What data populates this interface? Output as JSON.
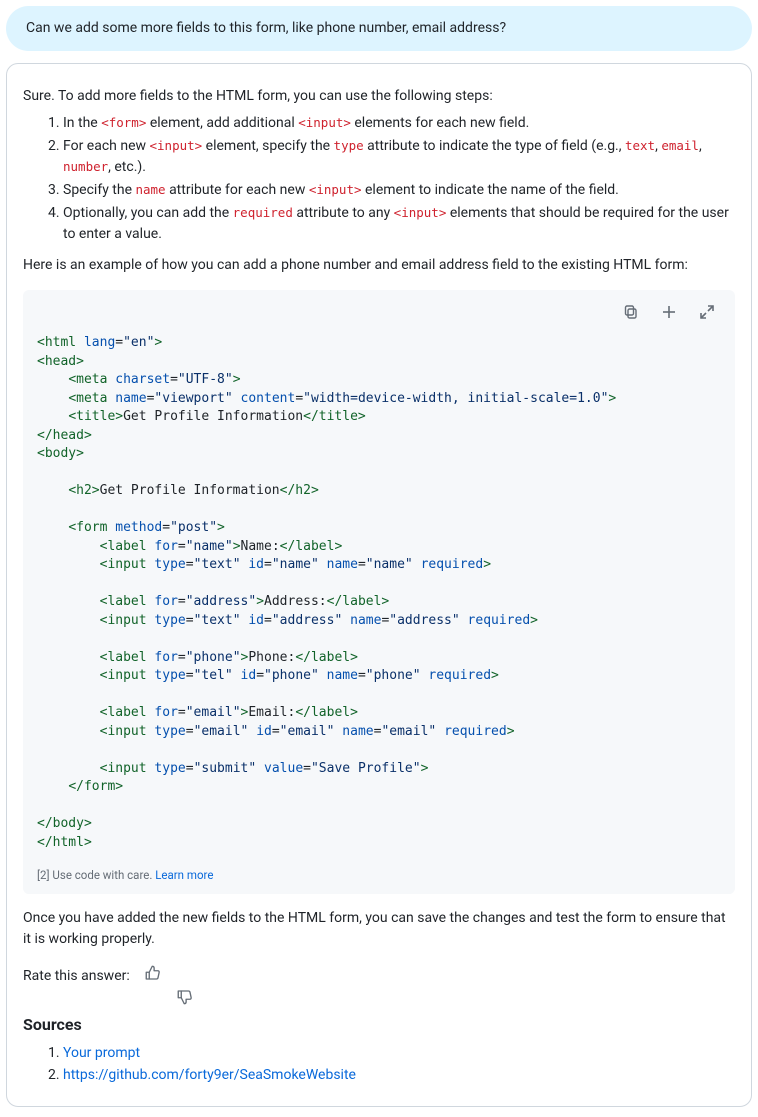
{
  "user_message": "Can we add some more fields to this form, like phone number, email address?",
  "answer": {
    "intro": "Sure. To add more fields to the HTML form, you can use the following steps:",
    "steps": [
      [
        {
          "t": "In the "
        },
        {
          "c": "<form>"
        },
        {
          "t": " element, add additional "
        },
        {
          "c": "<input>"
        },
        {
          "t": " elements for each new field."
        }
      ],
      [
        {
          "t": "For each new "
        },
        {
          "c": "<input>"
        },
        {
          "t": " element, specify the "
        },
        {
          "c": "type"
        },
        {
          "t": " attribute to indicate the type of field (e.g., "
        },
        {
          "c": "text"
        },
        {
          "t": ", "
        },
        {
          "c": "email"
        },
        {
          "t": ", "
        },
        {
          "c": "number"
        },
        {
          "t": ", etc.)."
        }
      ],
      [
        {
          "t": "Specify the "
        },
        {
          "c": "name"
        },
        {
          "t": " attribute for each new "
        },
        {
          "c": "<input>"
        },
        {
          "t": " element to indicate the name of the field."
        }
      ],
      [
        {
          "t": "Optionally, you can add the "
        },
        {
          "c": "required"
        },
        {
          "t": " attribute to any "
        },
        {
          "c": "<input>"
        },
        {
          "t": " elements that should be required for the user to enter a value."
        }
      ]
    ],
    "example_lead": "Here is an example of how you can add a phone number and email address field to the existing HTML form:",
    "code_lines": [
      [
        [
          "tag",
          "<html"
        ],
        [
          "punc",
          " "
        ],
        [
          "attr",
          "lang"
        ],
        [
          "punc",
          "="
        ],
        [
          "str",
          "\"en\""
        ],
        [
          "tag",
          ">"
        ]
      ],
      [
        [
          "tag",
          "<head>"
        ]
      ],
      [
        [
          "punc",
          "    "
        ],
        [
          "tag",
          "<meta"
        ],
        [
          "punc",
          " "
        ],
        [
          "attr",
          "charset"
        ],
        [
          "punc",
          "="
        ],
        [
          "str",
          "\"UTF-8\""
        ],
        [
          "tag",
          ">"
        ]
      ],
      [
        [
          "punc",
          "    "
        ],
        [
          "tag",
          "<meta"
        ],
        [
          "punc",
          " "
        ],
        [
          "attr",
          "name"
        ],
        [
          "punc",
          "="
        ],
        [
          "str",
          "\"viewport\""
        ],
        [
          "punc",
          " "
        ],
        [
          "attr",
          "content"
        ],
        [
          "punc",
          "="
        ],
        [
          "str",
          "\"width=device-width, initial-scale=1.0\""
        ],
        [
          "tag",
          ">"
        ]
      ],
      [
        [
          "punc",
          "    "
        ],
        [
          "tag",
          "<title>"
        ],
        [
          "text",
          "Get Profile Information"
        ],
        [
          "tag",
          "</title>"
        ]
      ],
      [
        [
          "tag",
          "</head>"
        ]
      ],
      [
        [
          "tag",
          "<body>"
        ]
      ],
      [],
      [
        [
          "punc",
          "    "
        ],
        [
          "tag",
          "<h2>"
        ],
        [
          "text",
          "Get Profile Information"
        ],
        [
          "tag",
          "</h2>"
        ]
      ],
      [],
      [
        [
          "punc",
          "    "
        ],
        [
          "tag",
          "<form"
        ],
        [
          "punc",
          " "
        ],
        [
          "attr",
          "method"
        ],
        [
          "punc",
          "="
        ],
        [
          "str",
          "\"post\""
        ],
        [
          "tag",
          ">"
        ]
      ],
      [
        [
          "punc",
          "        "
        ],
        [
          "tag",
          "<label"
        ],
        [
          "punc",
          " "
        ],
        [
          "attr",
          "for"
        ],
        [
          "punc",
          "="
        ],
        [
          "str",
          "\"name\""
        ],
        [
          "tag",
          ">"
        ],
        [
          "text",
          "Name:"
        ],
        [
          "tag",
          "</label>"
        ]
      ],
      [
        [
          "punc",
          "        "
        ],
        [
          "tag",
          "<input"
        ],
        [
          "punc",
          " "
        ],
        [
          "attr",
          "type"
        ],
        [
          "punc",
          "="
        ],
        [
          "str",
          "\"text\""
        ],
        [
          "punc",
          " "
        ],
        [
          "attr",
          "id"
        ],
        [
          "punc",
          "="
        ],
        [
          "str",
          "\"name\""
        ],
        [
          "punc",
          " "
        ],
        [
          "attr",
          "name"
        ],
        [
          "punc",
          "="
        ],
        [
          "str",
          "\"name\""
        ],
        [
          "punc",
          " "
        ],
        [
          "attr",
          "required"
        ],
        [
          "tag",
          ">"
        ]
      ],
      [],
      [
        [
          "punc",
          "        "
        ],
        [
          "tag",
          "<label"
        ],
        [
          "punc",
          " "
        ],
        [
          "attr",
          "for"
        ],
        [
          "punc",
          "="
        ],
        [
          "str",
          "\"address\""
        ],
        [
          "tag",
          ">"
        ],
        [
          "text",
          "Address:"
        ],
        [
          "tag",
          "</label>"
        ]
      ],
      [
        [
          "punc",
          "        "
        ],
        [
          "tag",
          "<input"
        ],
        [
          "punc",
          " "
        ],
        [
          "attr",
          "type"
        ],
        [
          "punc",
          "="
        ],
        [
          "str",
          "\"text\""
        ],
        [
          "punc",
          " "
        ],
        [
          "attr",
          "id"
        ],
        [
          "punc",
          "="
        ],
        [
          "str",
          "\"address\""
        ],
        [
          "punc",
          " "
        ],
        [
          "attr",
          "name"
        ],
        [
          "punc",
          "="
        ],
        [
          "str",
          "\"address\""
        ],
        [
          "punc",
          " "
        ],
        [
          "attr",
          "required"
        ],
        [
          "tag",
          ">"
        ]
      ],
      [],
      [
        [
          "punc",
          "        "
        ],
        [
          "tag",
          "<label"
        ],
        [
          "punc",
          " "
        ],
        [
          "attr",
          "for"
        ],
        [
          "punc",
          "="
        ],
        [
          "str",
          "\"phone\""
        ],
        [
          "tag",
          ">"
        ],
        [
          "text",
          "Phone:"
        ],
        [
          "tag",
          "</label>"
        ]
      ],
      [
        [
          "punc",
          "        "
        ],
        [
          "tag",
          "<input"
        ],
        [
          "punc",
          " "
        ],
        [
          "attr",
          "type"
        ],
        [
          "punc",
          "="
        ],
        [
          "str",
          "\"tel\""
        ],
        [
          "punc",
          " "
        ],
        [
          "attr",
          "id"
        ],
        [
          "punc",
          "="
        ],
        [
          "str",
          "\"phone\""
        ],
        [
          "punc",
          " "
        ],
        [
          "attr",
          "name"
        ],
        [
          "punc",
          "="
        ],
        [
          "str",
          "\"phone\""
        ],
        [
          "punc",
          " "
        ],
        [
          "attr",
          "required"
        ],
        [
          "tag",
          ">"
        ]
      ],
      [],
      [
        [
          "punc",
          "        "
        ],
        [
          "tag",
          "<label"
        ],
        [
          "punc",
          " "
        ],
        [
          "attr",
          "for"
        ],
        [
          "punc",
          "="
        ],
        [
          "str",
          "\"email\""
        ],
        [
          "tag",
          ">"
        ],
        [
          "text",
          "Email:"
        ],
        [
          "tag",
          "</label>"
        ]
      ],
      [
        [
          "punc",
          "        "
        ],
        [
          "tag",
          "<input"
        ],
        [
          "punc",
          " "
        ],
        [
          "attr",
          "type"
        ],
        [
          "punc",
          "="
        ],
        [
          "str",
          "\"email\""
        ],
        [
          "punc",
          " "
        ],
        [
          "attr",
          "id"
        ],
        [
          "punc",
          "="
        ],
        [
          "str",
          "\"email\""
        ],
        [
          "punc",
          " "
        ],
        [
          "attr",
          "name"
        ],
        [
          "punc",
          "="
        ],
        [
          "str",
          "\"email\""
        ],
        [
          "punc",
          " "
        ],
        [
          "attr",
          "required"
        ],
        [
          "tag",
          ">"
        ]
      ],
      [],
      [
        [
          "punc",
          "        "
        ],
        [
          "tag",
          "<input"
        ],
        [
          "punc",
          " "
        ],
        [
          "attr",
          "type"
        ],
        [
          "punc",
          "="
        ],
        [
          "str",
          "\"submit\""
        ],
        [
          "punc",
          " "
        ],
        [
          "attr",
          "value"
        ],
        [
          "punc",
          "="
        ],
        [
          "str",
          "\"Save Profile\""
        ],
        [
          "tag",
          ">"
        ]
      ],
      [
        [
          "punc",
          "    "
        ],
        [
          "tag",
          "</form>"
        ]
      ],
      [],
      [
        [
          "tag",
          "</body>"
        ]
      ],
      [
        [
          "tag",
          "</html>"
        ]
      ]
    ],
    "code_note_ref": "[2]",
    "code_note_text": "Use code with care.",
    "code_note_link": "Learn more",
    "closing": "Once you have added the new fields to the HTML form, you can save the changes and test the form to ensure that it is working properly.",
    "rate_label": "Rate this answer:",
    "sources_heading": "Sources",
    "sources": [
      "Your prompt",
      "https://github.com/forty9er/SeaSmokeWebsite"
    ]
  }
}
